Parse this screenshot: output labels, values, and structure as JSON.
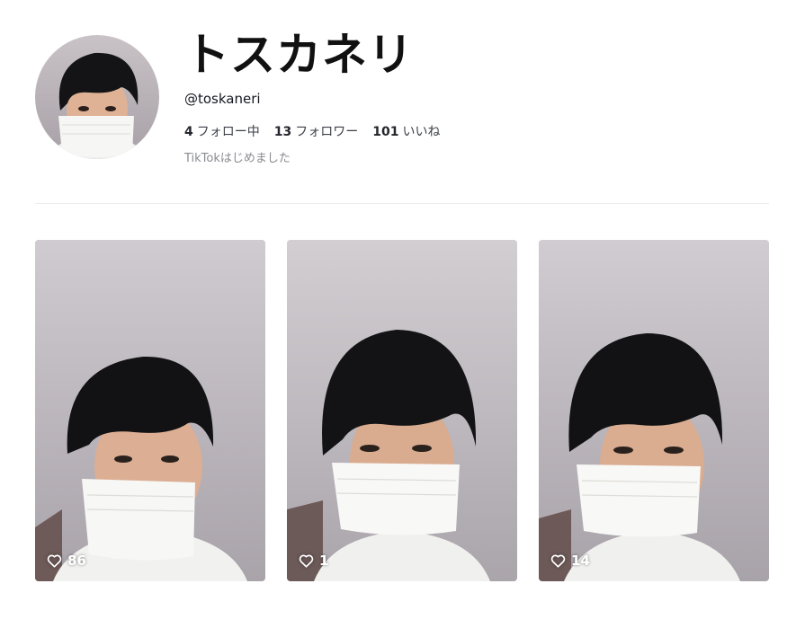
{
  "profile": {
    "display_name": "トスカネリ",
    "handle": "@toskaneri",
    "following_count": "4",
    "following_label": "フォロー中",
    "followers_count": "13",
    "followers_label": "フォロワー",
    "likes_count": "101",
    "likes_label": "いいね",
    "bio": "TikTokはじめました",
    "avatar_icon": "avatar-photo"
  },
  "videos": [
    {
      "likes": "86",
      "icon": "heart-outline-icon"
    },
    {
      "likes": "1",
      "icon": "heart-outline-icon"
    },
    {
      "likes": "14",
      "icon": "heart-outline-icon"
    }
  ],
  "colors": {
    "text_primary": "#161823",
    "text_secondary": "#8a8b91",
    "divider": "#ececed"
  }
}
